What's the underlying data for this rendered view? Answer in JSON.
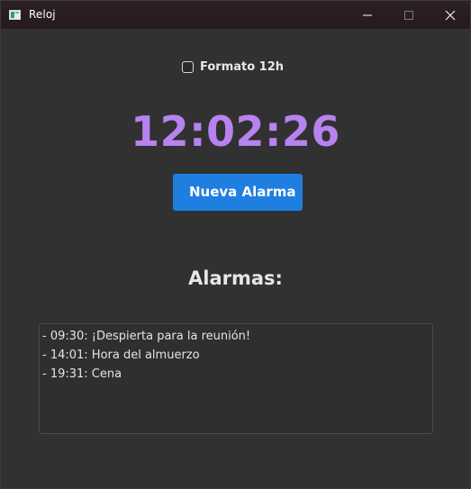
{
  "window": {
    "title": "Reloj",
    "icon": "app-window-icon",
    "controls": [
      "minimize-icon",
      "maximize-icon",
      "close-icon"
    ]
  },
  "format_toggle": {
    "label": "Formato 12h",
    "checked": false
  },
  "clock": {
    "time": "12:02:26",
    "color": "#b683f0"
  },
  "new_alarm_button": {
    "label": "Nueva Alarma",
    "color": "#1f7fe0"
  },
  "alarms": {
    "heading": "Alarmas:",
    "items": [
      "- 09:30: ¡Despierta para la reunión!",
      "- 14:01: Hora del almuerzo",
      "- 19:31: Cena"
    ]
  }
}
